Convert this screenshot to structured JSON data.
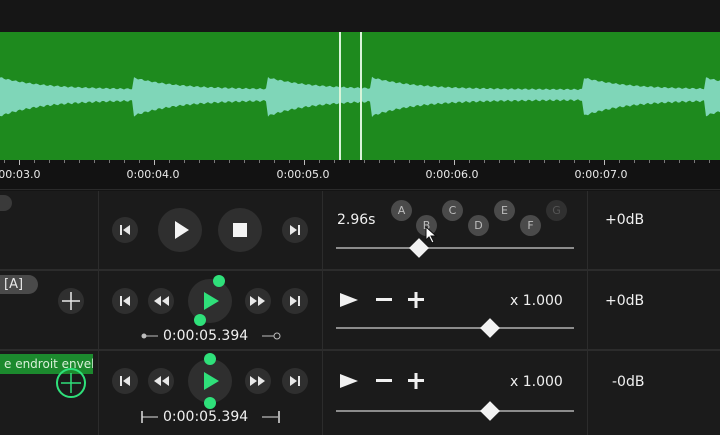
{
  "timeline": {
    "ticks": [
      "0:00:03.0",
      "0:00:04.0",
      "0:00:05.0",
      "0:00:06.0",
      "0:00:07.0"
    ]
  },
  "row1": {
    "duration": "2.96s",
    "keys": [
      "A",
      "B",
      "C",
      "D",
      "E",
      "F",
      "G"
    ],
    "gain": "+0dB"
  },
  "row2": {
    "badge": "[A]",
    "time": "0:00:05.394",
    "rate": "x 1.000",
    "gain": "+0dB"
  },
  "row3": {
    "label": "e endroit envel",
    "time": "0:00:05.394",
    "rate": "x 1.000",
    "gain": "-0dB"
  },
  "colors": {
    "waveform_bg": "#1e8a1e",
    "wave": "#7fd6b8",
    "accent": "#2fe07a"
  }
}
